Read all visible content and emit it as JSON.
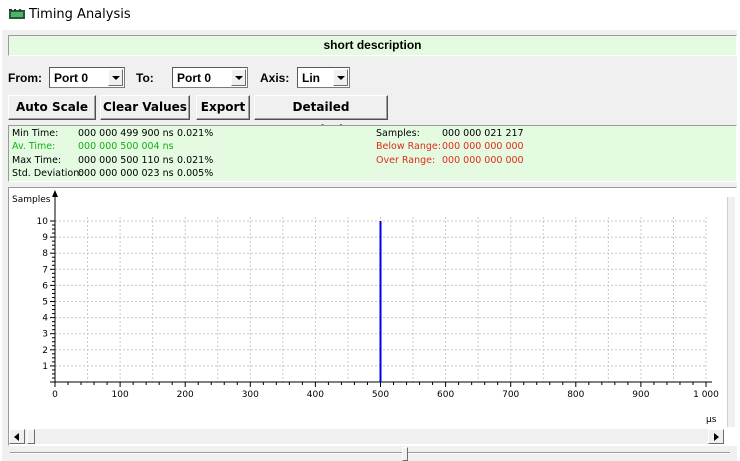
{
  "window": {
    "title": "Timing Analysis",
    "icon": "app-icon"
  },
  "description": "short description",
  "controls": {
    "from_label": "From:",
    "from_value": "Port 0",
    "to_label": "To:",
    "to_value": "Port 0",
    "axis_label": "Axis:",
    "axis_value": "Lin"
  },
  "buttons": {
    "auto_scale": "Auto Scale",
    "clear_values": "Clear Values",
    "export": "Export",
    "detailed_description": "Detailed Description"
  },
  "stats": {
    "min_label": "Min Time:",
    "min_value": "000 000 499 900 ns",
    "min_pct": "0.021%",
    "av_label": "Av. Time:",
    "av_value": "000 000 500 004 ns",
    "max_label": "Max Time:",
    "max_value": "000 000 500 110 ns",
    "max_pct": "0.021%",
    "std_label": "Std. Deviation:",
    "std_value": "000 000 000 023 ns",
    "std_pct": "0.005%",
    "samples_label": "Samples:",
    "samples_value": "000 000 021 217",
    "below_label": "Below Range:",
    "below_value": "000 000 000 000",
    "over_label": "Over Range:",
    "over_value": "000 000 000 000"
  },
  "colors": {
    "green_panel": "#e4fbe2",
    "green_text": "#13b013",
    "red_text": "#e02c1c",
    "bar": "#0000ee"
  },
  "chart_data": {
    "type": "bar",
    "ylabel": "Samples",
    "xlabel": "µs",
    "xlim": [
      0,
      1000
    ],
    "ylim": [
      0,
      10
    ],
    "x_ticks": [
      0,
      100,
      200,
      300,
      400,
      500,
      600,
      700,
      800,
      900,
      1000
    ],
    "x_tick_labels": [
      "0",
      "100",
      "200",
      "300",
      "400",
      "500",
      "600",
      "700",
      "800",
      "900",
      "1 000"
    ],
    "y_ticks": [
      1,
      2,
      3,
      4,
      5,
      6,
      7,
      8,
      9,
      10
    ],
    "grid": true,
    "series": [
      {
        "x": [
          500
        ],
        "values": [
          10
        ]
      }
    ]
  }
}
